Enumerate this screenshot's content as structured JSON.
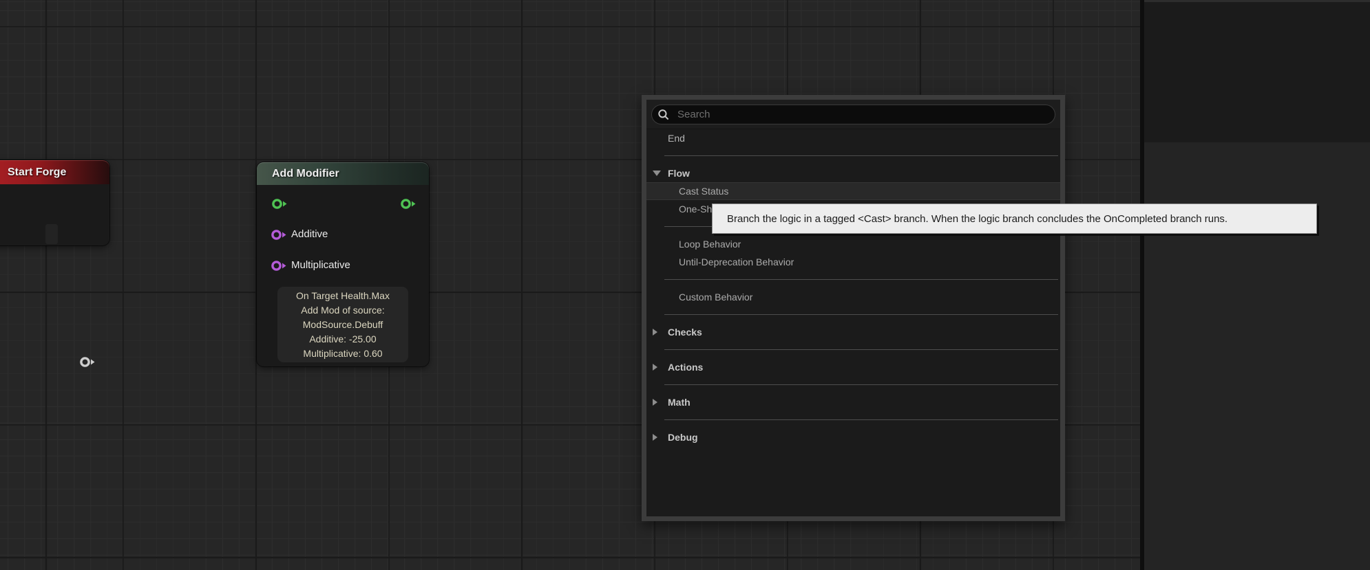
{
  "colors": {
    "exec_pin_green": "#4fc353",
    "data_pin_purple": "#b55cd9",
    "start_pin_gray": "#cdcdcd",
    "start_header_red": "#9f1d21",
    "modifier_header_green": "#35473d",
    "menu_highlight": "#292929",
    "tooltip_bg": "#ededed"
  },
  "nodes": {
    "start_forge": {
      "title": "Start Forge"
    },
    "add_modifier": {
      "title": "Add Modifier",
      "additive_label": "Additive",
      "multiplicative_label": "Multiplicative",
      "info_lines": [
        "On Target Health.Max",
        "Add Mod of source:",
        "ModSource.Debuff",
        "Additive: -25.00",
        "Multiplicative: 0.60"
      ]
    }
  },
  "context_menu": {
    "search_placeholder": "Search",
    "rows": [
      {
        "type": "item",
        "label": "End",
        "indent": 0
      },
      {
        "type": "divider"
      },
      {
        "type": "header",
        "label": "Flow",
        "expanded": true
      },
      {
        "type": "item",
        "label": "Cast Status",
        "indent": 1,
        "highlighted": true
      },
      {
        "type": "item",
        "label": "One-Shot",
        "indent": 1
      },
      {
        "type": "divider"
      },
      {
        "type": "item",
        "label": "Loop Behavior",
        "indent": 1
      },
      {
        "type": "item",
        "label": "Until-Deprecation Behavior",
        "indent": 1
      },
      {
        "type": "divider"
      },
      {
        "type": "item",
        "label": "Custom Behavior",
        "indent": 1
      },
      {
        "type": "divider"
      },
      {
        "type": "header",
        "label": "Checks",
        "expanded": false
      },
      {
        "type": "divider"
      },
      {
        "type": "header",
        "label": "Actions",
        "expanded": false
      },
      {
        "type": "divider"
      },
      {
        "type": "header",
        "label": "Math",
        "expanded": false
      },
      {
        "type": "divider"
      },
      {
        "type": "header",
        "label": "Debug",
        "expanded": false
      }
    ]
  },
  "tooltip": {
    "text": "Branch the logic in a tagged <Cast> branch. When the logic branch concludes the OnCompleted branch runs."
  }
}
